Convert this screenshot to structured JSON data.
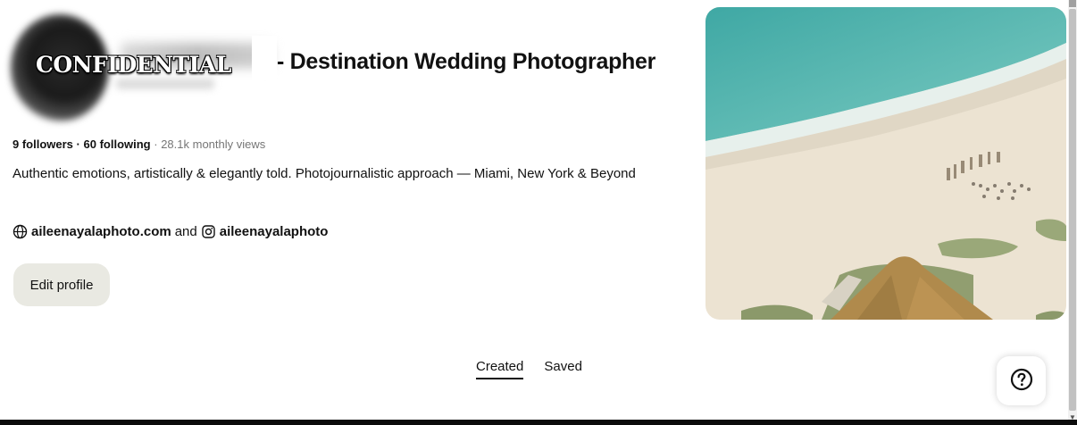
{
  "profile": {
    "title": "- Destination Wedding Photographer",
    "watermark": "CONFIDENTIAL",
    "followers": "9 followers",
    "stats_sep": "·",
    "following": "60 following",
    "monthly_views": "· 28.1k monthly views",
    "bio": "Authentic emotions, artistically & elegantly told. Photojournalistic approach — Miami, New York & Beyond",
    "website": "aileenayalaphoto.com",
    "links_and": "and",
    "instagram": "aileenayalaphoto"
  },
  "actions": {
    "edit_profile": "Edit profile"
  },
  "tabs": [
    {
      "label": "Created",
      "active": true
    },
    {
      "label": "Saved",
      "active": false
    }
  ],
  "icons": {
    "website": "globe-icon",
    "instagram": "instagram-icon",
    "help": "question-mark-icon"
  },
  "colors": {
    "button_bg": "#e9e9e2",
    "text": "#111111",
    "muted": "#767676",
    "ocean": "#5fb8b0",
    "sand": "#ede4d3"
  }
}
